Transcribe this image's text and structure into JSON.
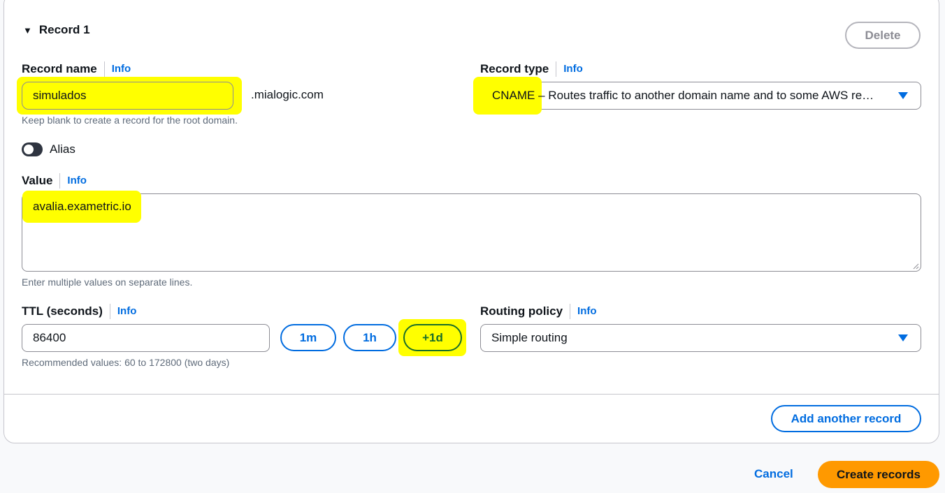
{
  "record": {
    "header": "Record 1",
    "delete_label": "Delete",
    "name": {
      "label": "Record name",
      "info": "Info",
      "value": "simulados",
      "suffix": ".mialogic.com",
      "hint": "Keep blank to create a record for the root domain."
    },
    "type": {
      "label": "Record type",
      "info": "Info",
      "selected_code": "CNAME",
      "selected_desc": " – Routes traffic to another domain name and to some AWS re…"
    },
    "alias": {
      "label": "Alias",
      "enabled": false
    },
    "value": {
      "label": "Value",
      "info": "Info",
      "text": "avalia.exametric.io",
      "hint": "Enter multiple values on separate lines."
    },
    "ttl": {
      "label": "TTL (seconds)",
      "info": "Info",
      "value": "86400",
      "hint": "Recommended values: 60 to 172800 (two days)",
      "presets": [
        "1m",
        "1h",
        "+1d"
      ]
    },
    "routing": {
      "label": "Routing policy",
      "info": "Info",
      "selected": "Simple routing"
    }
  },
  "actions": {
    "add_another": "Add another record",
    "cancel": "Cancel",
    "create": "Create records"
  },
  "colors": {
    "highlight": "#ffff00",
    "link_blue": "#006ce0",
    "primary_orange": "#ff9900"
  }
}
